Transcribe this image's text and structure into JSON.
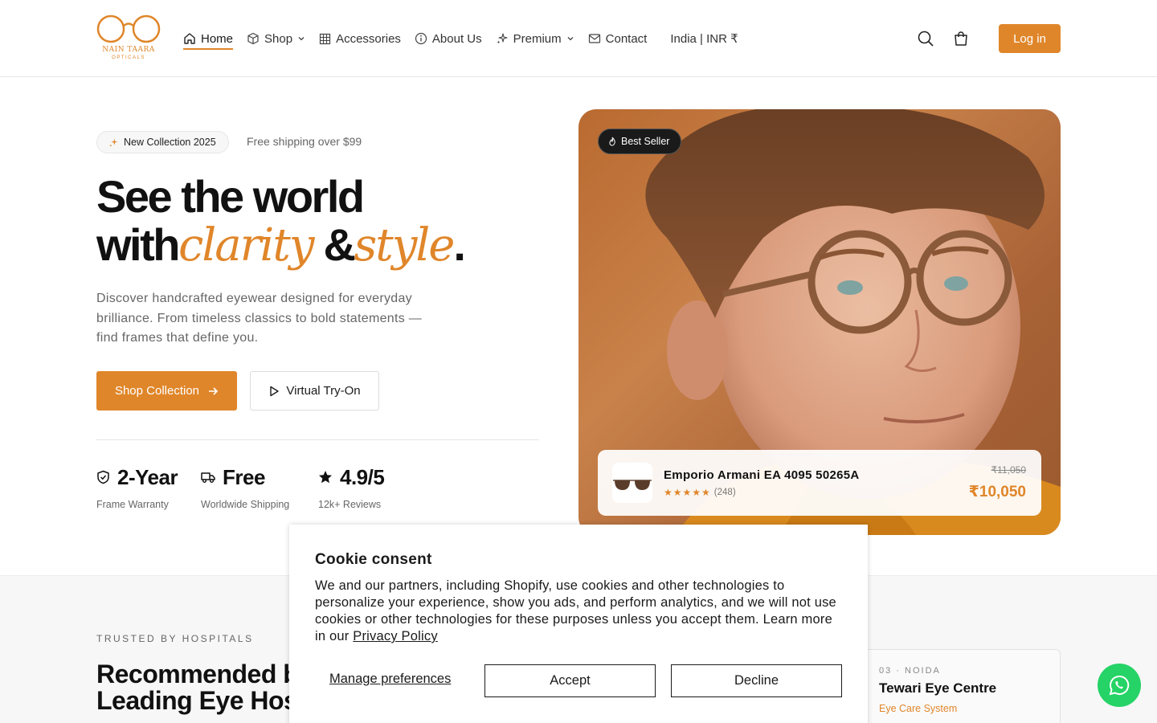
{
  "brand": {
    "name": "NAIN TAARA",
    "sub": "OPTICALS",
    "accent_color": "#e0862a"
  },
  "nav": {
    "items": [
      {
        "label": "Home",
        "icon": "home-icon",
        "active": true
      },
      {
        "label": "Shop",
        "icon": "box-icon",
        "dropdown": true
      },
      {
        "label": "Accessories",
        "icon": "grid-icon"
      },
      {
        "label": "About Us",
        "icon": "info-icon"
      },
      {
        "label": "Premium",
        "icon": "sparkles-icon",
        "dropdown": true
      },
      {
        "label": "Contact",
        "icon": "mail-icon"
      }
    ],
    "region": "India | INR ₹",
    "login_label": "Log in"
  },
  "hero": {
    "pill_label": "New Collection 2025",
    "free_shipping": "Free shipping over $99",
    "title_line1": "See the world",
    "title_with": "with",
    "title_clarity": "clarity",
    "title_amp": " &",
    "title_style": "style",
    "title_dot": ".",
    "description": "Discover handcrafted eyewear designed for everyday brilliance. From timeless classics to bold statements — find frames that define you.",
    "cta_primary": "Shop Collection",
    "cta_secondary": "Virtual Try-On",
    "stats": [
      {
        "value": "2-Year",
        "label": "Frame Warranty",
        "icon": "shield-check-icon"
      },
      {
        "value": "Free",
        "label": "Worldwide Shipping",
        "icon": "truck-icon"
      },
      {
        "value": "4.9/5",
        "label": "12k+ Reviews",
        "icon": "star-icon"
      }
    ]
  },
  "feature": {
    "badge": "Best Seller",
    "product": {
      "name": "Emporio Armani EA 4095 50265A",
      "stars": "★★★★★",
      "reviews": "(248)",
      "old_price": "₹11,050",
      "price": "₹10,050"
    }
  },
  "trusted": {
    "eyebrow": "TRUSTED BY HOSPITALS",
    "title_line1": "Recommended b",
    "title_line2": "Leading Eye Hos",
    "card": {
      "number": "03 · NOIDA",
      "name": "Tewari Eye Centre",
      "type": "Eye Care System"
    }
  },
  "cookie": {
    "title": "Cookie consent",
    "text": "We and our partners, including Shopify, use cookies and other technologies to personalize your experience, show you ads, and perform analytics, and we will not use cookies or other technologies for these purposes unless you accept them. Learn more in our",
    "link": "Privacy Policy",
    "manage": "Manage preferences",
    "accept": "Accept",
    "decline": "Decline"
  }
}
